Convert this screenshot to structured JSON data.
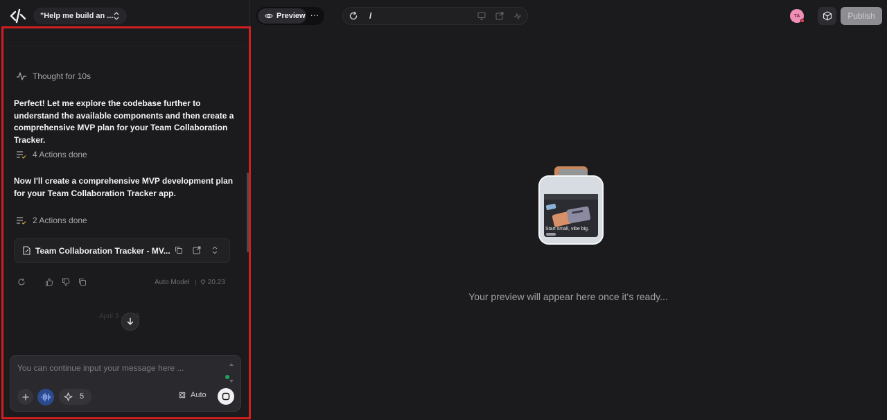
{
  "topbar": {
    "project_title": "\"Help me build an ...",
    "preview_label": "Preview",
    "more_label": "···",
    "url_path": "/",
    "avatar_initials": "TA",
    "publish_label": "Publish"
  },
  "chat": {
    "thought": "Thought for 10s",
    "message1": "Perfect! Let me explore the codebase further to understand the available components and then create a comprehensive MVP plan for your Team Collaboration Tracker.",
    "actions1": "4 Actions done",
    "message2": "Now I'll create a comprehensive MVP development plan for your Team Collaboration Tracker app.",
    "actions2": "2 Actions done",
    "doc_title": "Team Collaboration Tracker - MV...",
    "model_label": "Auto Model",
    "credits": "20.23",
    "date_ghost": "April 3 . . . 45"
  },
  "composer": {
    "placeholder": "You can continue input your message here ...",
    "spark_count": "5",
    "auto_label": "Auto"
  },
  "preview": {
    "empty_message": "Your preview will appear here once it's ready...",
    "card_caption": "Start small, vibe big."
  },
  "colors": {
    "accent_red_border": "#d11f1f",
    "background": "#1b1b1d",
    "publish_bg": "#8e8e92"
  }
}
